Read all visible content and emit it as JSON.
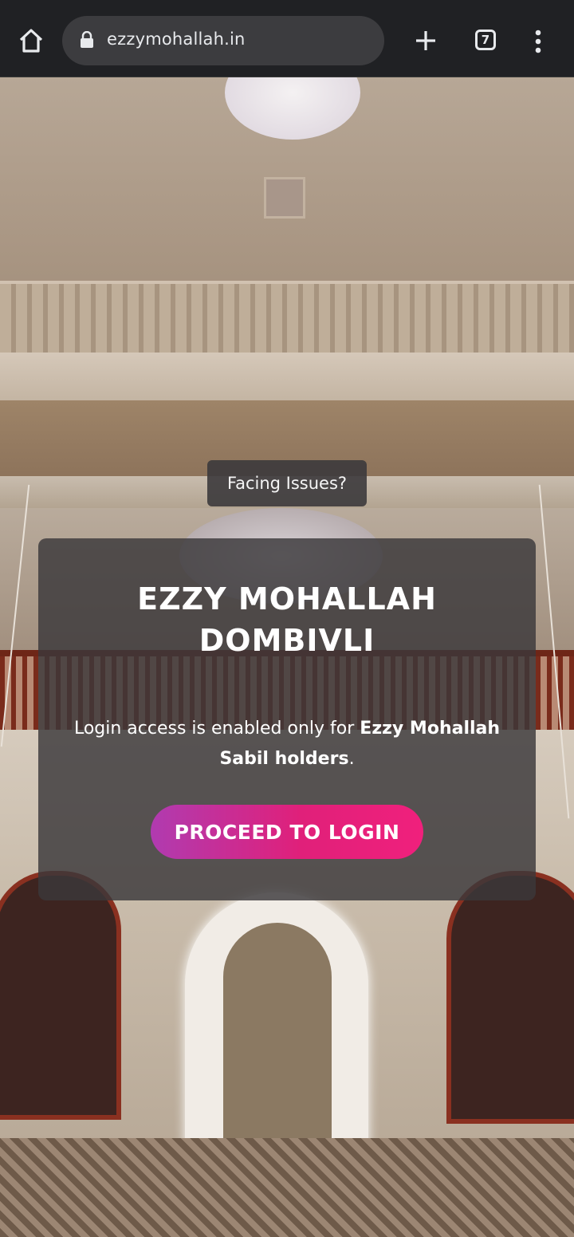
{
  "browser": {
    "url": "ezzymohallah.in",
    "tab_count": "7"
  },
  "page": {
    "issues_label": "Facing Issues?",
    "title_line1": "EZZY MOHALLAH",
    "title_line2": "DOMBIVLI",
    "notice_prefix": "Login access is enabled only for ",
    "notice_bold": "Ezzy Mohallah Sabil holders",
    "notice_suffix": ".",
    "login_button": "PROCEED TO LOGIN"
  },
  "colors": {
    "chrome_bg": "#202124",
    "card_bg": "rgba(58,56,58,0.82)",
    "button_gradient_start": "#b03bb0",
    "button_gradient_end": "#f0207c"
  }
}
